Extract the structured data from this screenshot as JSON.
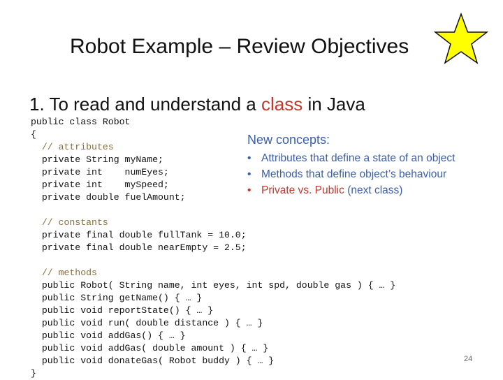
{
  "slide": {
    "title": "Robot Example – Review Objectives",
    "objective_prefix": "1.  To read and understand a ",
    "objective_highlight": "class",
    "objective_suffix": " in Java",
    "page_number": "24"
  },
  "code": {
    "lines": [
      {
        "text": "public class Robot",
        "kind": "code"
      },
      {
        "text": "{",
        "kind": "code"
      },
      {
        "text": "  // attributes",
        "kind": "comment"
      },
      {
        "text": "  private String myName;",
        "kind": "code"
      },
      {
        "text": "  private int    numEyes;",
        "kind": "code"
      },
      {
        "text": "  private int    mySpeed;",
        "kind": "code"
      },
      {
        "text": "  private double fuelAmount;",
        "kind": "code"
      },
      {
        "text": "",
        "kind": "code"
      },
      {
        "text": "  // constants",
        "kind": "comment"
      },
      {
        "text": "  private final double fullTank = 10.0;",
        "kind": "code"
      },
      {
        "text": "  private final double nearEmpty = 2.5;",
        "kind": "code"
      },
      {
        "text": "",
        "kind": "code"
      },
      {
        "text": "  // methods",
        "kind": "comment"
      },
      {
        "text": "  public Robot( String name, int eyes, int spd, double gas ) { … }",
        "kind": "code"
      },
      {
        "text": "  public String getName() { … }",
        "kind": "code"
      },
      {
        "text": "  public void reportState() { … }",
        "kind": "code"
      },
      {
        "text": "  public void run( double distance ) { … }",
        "kind": "code"
      },
      {
        "text": "  public void addGas() { … }",
        "kind": "code"
      },
      {
        "text": "  public void addGas( double amount ) { … }",
        "kind": "code"
      },
      {
        "text": "  public void donateGas( Robot buddy ) { … }",
        "kind": "code"
      },
      {
        "text": "}",
        "kind": "code"
      }
    ]
  },
  "concepts": {
    "heading": "New concepts:",
    "items": [
      {
        "text": "Attributes that define a state of an object",
        "extra": "",
        "color": "#3a5fa8"
      },
      {
        "text": "Methods that define object’s behaviour",
        "extra": "",
        "color": "#3a5fa8"
      },
      {
        "text": "Private vs. Public",
        "extra": " (next class)",
        "color": "#c0392b"
      }
    ]
  },
  "colors": {
    "accent_red": "#c0392b",
    "concept_blue": "#3a5fa8",
    "comment_brown": "#8a6d3b",
    "star_fill": "#ffff00"
  },
  "icons": {
    "star": "star-icon"
  }
}
